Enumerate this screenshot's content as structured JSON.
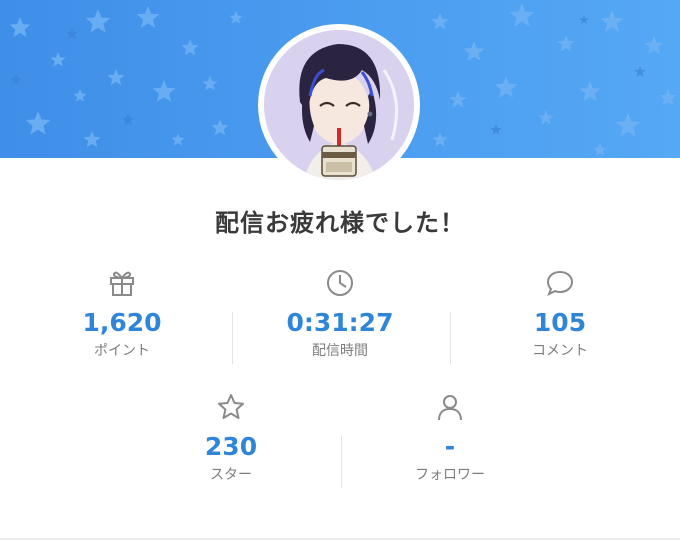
{
  "header": {
    "banner_color": "#4a9cf0",
    "avatar_alt": "avatar"
  },
  "summary": {
    "title": "配信お疲れ様でした！"
  },
  "stats": {
    "points": {
      "icon": "gift-icon",
      "value": "1,620",
      "label": "ポイント"
    },
    "time": {
      "icon": "clock-icon",
      "value": "0:31:27",
      "label": "配信時間"
    },
    "comments": {
      "icon": "comment-icon",
      "value": "105",
      "label": "コメント"
    },
    "stars": {
      "icon": "star-icon",
      "value": "230",
      "label": "スター"
    },
    "followers": {
      "icon": "person-icon",
      "value": "-",
      "label": "フォロワー"
    }
  },
  "colors": {
    "accent": "#2f86d8",
    "label": "#7d7d7d",
    "icon": "#8a8a8a"
  }
}
